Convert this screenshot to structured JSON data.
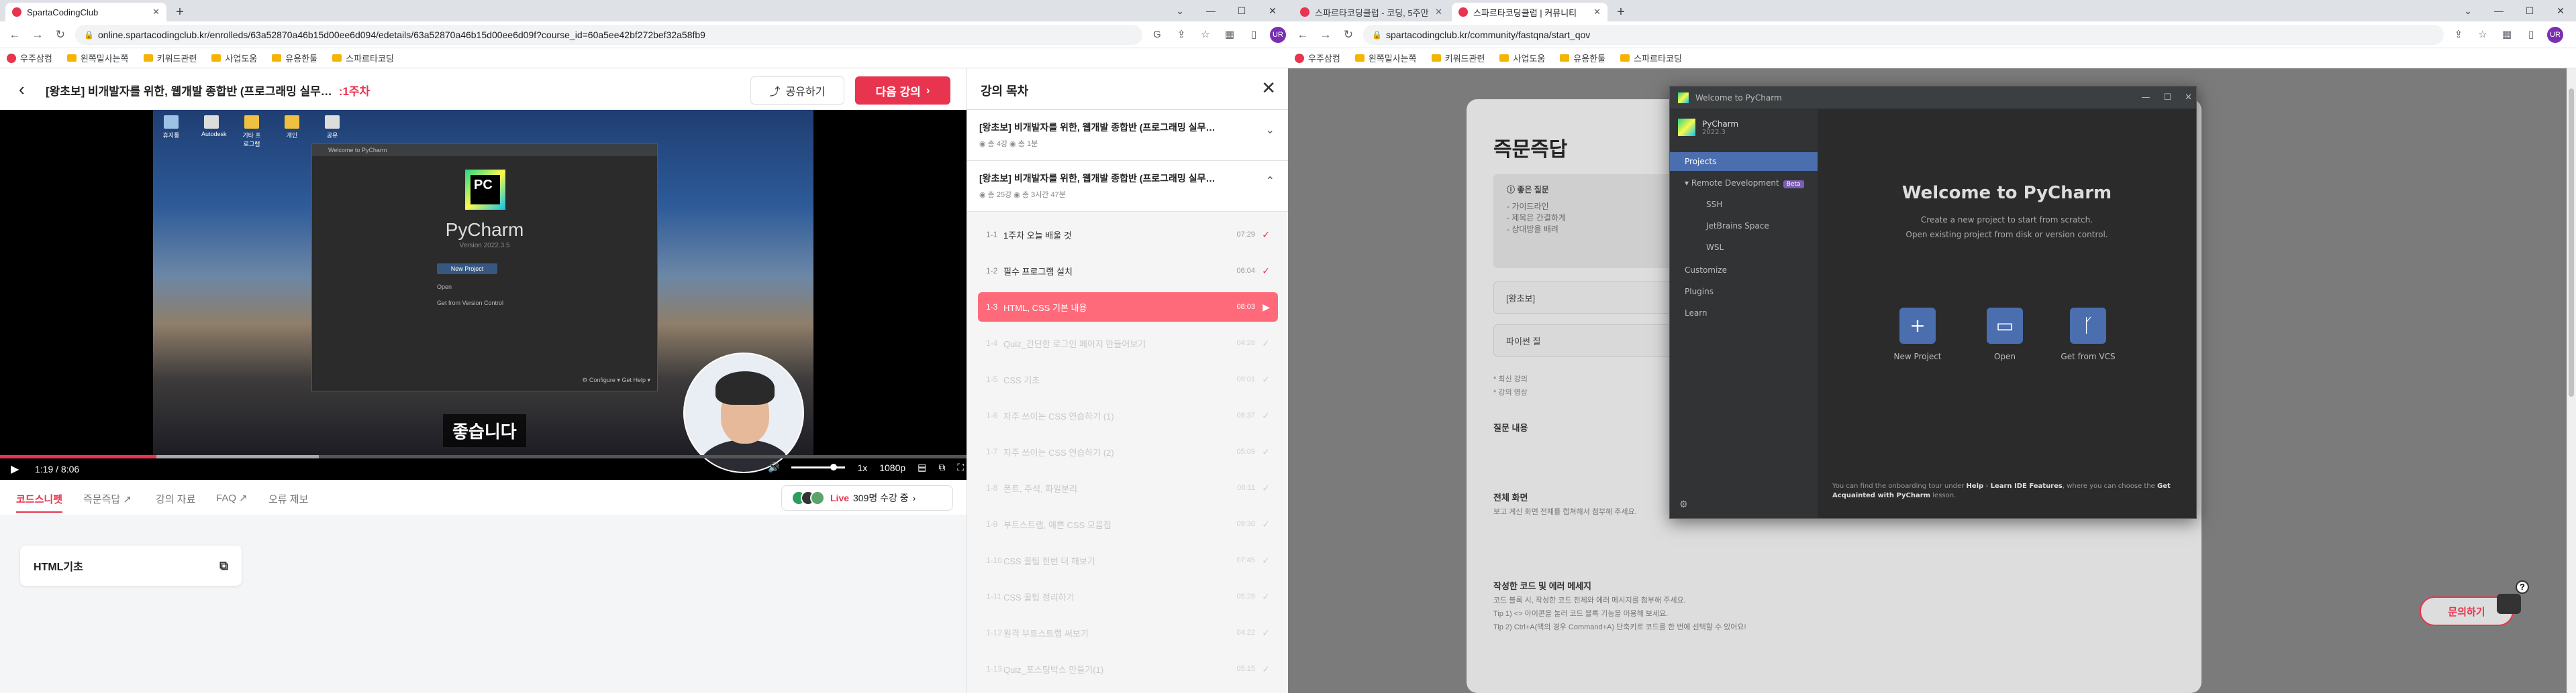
{
  "left_window": {
    "tabs": [
      {
        "title": "SpartaCodingClub",
        "active": true
      }
    ],
    "url": "online.spartacodingclub.kr/enrolleds/63a52870a46b15d00ee6d094/edetails/63a52870a46b15d00ee6d09f?course_id=60a5ee42bf272bef32a58fb9",
    "bookmarks": [
      "우주삼컴",
      "왼쪽밑사는쪽",
      "키워드관련",
      "사업도움",
      "유용한툴",
      "스파르타코딩"
    ],
    "header": {
      "title": "[왕초보] 비개발자를 위한, 웹개발 종합반 (프로그래밍 실무…",
      "week": "1주차",
      "share_label": "공유하기",
      "next_label": "다음 강의"
    },
    "player": {
      "desktop_icons": [
        "휴지통",
        "Autodesk",
        "기타 프로그램",
        "개인",
        "공유"
      ],
      "inner_title": "Welcome to PyCharm",
      "pycharm_name": "PyCharm",
      "pycharm_version": "Version 2022.3.5",
      "actions": [
        "New Project",
        "Open",
        "Get from Version Control"
      ],
      "footer": "⚙ Configure ▾   Get Help ▾",
      "caption": "좋습니다",
      "time_current": "1:19",
      "time_total": "8:06",
      "progress": 0.162,
      "buffered": 0.33,
      "speed": "1x",
      "quality": "1080p"
    },
    "tabs_row": {
      "items": [
        "코드스니펫",
        "즉문즉답 ↗",
        "강의 자료",
        "FAQ ↗",
        "오류 제보"
      ],
      "live_label": "Live",
      "live_count": "309명 수강 중"
    },
    "snippet": {
      "title": "HTML기초"
    },
    "toc": {
      "title": "강의 목차",
      "courses": [
        {
          "name": "[왕초보] 비개발자를 위한, 웹개발 종합반 (프로그래밍 실무…",
          "meta": "◉ 총 4강   ◉ 총 1분"
        },
        {
          "name": "[왕초보] 비개발자를 위한, 웹개발 종합반 (프로그래밍 실무…",
          "meta": "◉ 총 25강   ◉ 총 3시간 47분"
        }
      ],
      "lessons": [
        {
          "num": "1-1",
          "title": "1주차 오늘 배울 것",
          "dur": "07:29",
          "state": "done"
        },
        {
          "num": "1-2",
          "title": "필수 프로그램 설치",
          "dur": "06:04",
          "state": "done"
        },
        {
          "num": "1-3",
          "title": "HTML, CSS 기본 내용",
          "dur": "08:03",
          "state": "current"
        },
        {
          "num": "1-4",
          "title": "Quiz_간단한 로그인 페이지 만들어보기",
          "dur": "04:28",
          "state": "locked"
        },
        {
          "num": "1-5",
          "title": "CSS 기초",
          "dur": "09:01",
          "state": "locked"
        },
        {
          "num": "1-6",
          "title": "자주 쓰이는 CSS 연습하기 (1)",
          "dur": "08:37",
          "state": "locked"
        },
        {
          "num": "1-7",
          "title": "자주 쓰이는 CSS 연습하기 (2)",
          "dur": "05:09",
          "state": "locked"
        },
        {
          "num": "1-8",
          "title": "폰트, 주석, 파일분리",
          "dur": "06:11",
          "state": "locked"
        },
        {
          "num": "1-9",
          "title": "부트스트랩, 예쁜 CSS 모음집",
          "dur": "09:30",
          "state": "locked"
        },
        {
          "num": "1-10",
          "title": "CSS 꿀팁 한번 더 해보기",
          "dur": "07:45",
          "state": "locked"
        },
        {
          "num": "1-11",
          "title": "CSS 꿀팁 정리하기",
          "dur": "05:28",
          "state": "locked"
        },
        {
          "num": "1-12",
          "title": "원격 부트스트랩 써보기",
          "dur": "04:22",
          "state": "locked"
        },
        {
          "num": "1-13",
          "title": "Quiz_포스팅박스 만들기(1)",
          "dur": "05:15",
          "state": "locked"
        }
      ]
    }
  },
  "right_window": {
    "tabs": [
      {
        "title": "스파르타코딩클럽 - 코딩, 5주만…",
        "active": false
      },
      {
        "title": "스파르타코딩클럽 | 커뮤니티",
        "active": true
      }
    ],
    "url": "spartacodingclub.kr/community/fastqna/start_qov",
    "bookmarks": [
      "우주삼컴",
      "왼쪽밑사는쪽",
      "키워드관련",
      "사업도움",
      "유용한툴",
      "스파르타코딩"
    ],
    "form": {
      "title": "즉문즉답",
      "notice_head": "ⓘ 좋은 질문",
      "notice_lines": [
        "- 가이드라인",
        "- 제목은 간결하게",
        "- 상대방을 배려"
      ],
      "select_value": "[왕초보]",
      "input_placeholder": "파이썬 질",
      "hint_lines": [
        "* 최신 강의",
        "* 강의 영상"
      ],
      "section1": "질문 내용",
      "section2": "전체 화면",
      "section2_help": "보고 계신 화면 전체를 캡쳐해서 첨부해 주세요.",
      "section3": "작성한 코드 및 에러 메세지",
      "section3_help": [
        "코드 블록 시, 작성한 코드 전체와 에러 메시지를 첨부해 주세요.",
        "Tip 1) <> 아이콘을 눌러 코드 블록 기능을 이용해 보세요.",
        "Tip 2) Ctrl+A(맥의 경우 Command+A) 단축키로 코드를 한 번에 선택할 수 있어요!"
      ],
      "inquiry_label": "문의하기"
    },
    "pycharm": {
      "window_title": "Welcome to PyCharm",
      "brand": "PyCharm",
      "version": "2022.3",
      "nav": [
        "Projects",
        "Remote Development",
        "SSH",
        "JetBrains Space",
        "WSL",
        "Customize",
        "Plugins",
        "Learn"
      ],
      "beta": "Beta",
      "welcome": "Welcome to PyCharm",
      "sub1": "Create a new project to start from scratch.",
      "sub2": "Open existing project from disk or version control.",
      "actions": [
        "New Project",
        "Open",
        "Get from VCS"
      ],
      "tip_pre": "You can find the onboarding tour under",
      "tip_help": "Help",
      "tip_mid": "›",
      "tip_learn": "Learn IDE Features",
      "tip_post": ", where you can choose the",
      "tip_get": "Get Acquainted with PyCharm",
      "tip_end": "lesson."
    }
  },
  "colors": {
    "accent": "#e8344e",
    "accent_soft": "#ff6a7b",
    "pycharm_blue": "#4b6eaf"
  }
}
